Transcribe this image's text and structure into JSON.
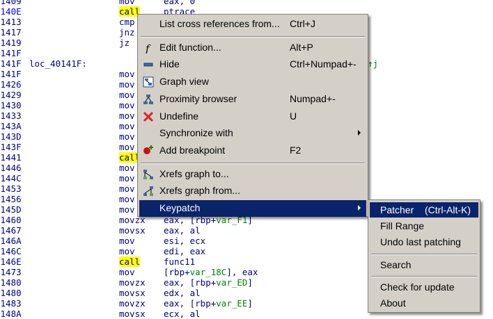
{
  "disasm": [
    {
      "addr": "01409",
      "mn": "mov",
      "op": "eax, 0"
    },
    {
      "addr": "0140E",
      "mn": "call",
      "op": "ptrace",
      "call": true,
      "addr_blue": true
    },
    {
      "addr": "01413",
      "mn": "cmp",
      "op": ""
    },
    {
      "addr": "01417",
      "mn": "jnz",
      "op": ""
    },
    {
      "addr": "01419",
      "mn": "jz",
      "op": ""
    },
    {
      "addr": "0141F",
      "mn": "",
      "op": ""
    },
    {
      "addr": "0141F",
      "label": "loc_40141F:",
      "mn": "",
      "op": "",
      "xref": "↑j"
    },
    {
      "addr": "0141F",
      "mn": "mov",
      "op": ""
    },
    {
      "addr": "01426",
      "mn": "mov",
      "op": ""
    },
    {
      "addr": "01429",
      "mn": "mov",
      "op": ""
    },
    {
      "addr": "01430",
      "mn": "mov",
      "op": ""
    },
    {
      "addr": "01433",
      "mn": "mov",
      "op": ""
    },
    {
      "addr": "0143A",
      "mn": "mov",
      "op": ""
    },
    {
      "addr": "0143D",
      "mn": "mov",
      "op": ""
    },
    {
      "addr": "0143F",
      "mn": "mov",
      "op": ""
    },
    {
      "addr": "01441",
      "mn": "call",
      "op": "",
      "call": true
    },
    {
      "addr": "01446",
      "mn": "mov",
      "op": ""
    },
    {
      "addr": "0144C",
      "mn": "mov",
      "op": ""
    },
    {
      "addr": "01453",
      "mn": "mov",
      "op": ""
    },
    {
      "addr": "01456",
      "mn": "mov",
      "op": ""
    },
    {
      "addr": "0145D",
      "mn": "mov",
      "op": ""
    },
    {
      "addr": "01460",
      "mn": "movzx",
      "op": "eax, [rbp+",
      "var": "var_F1",
      "op2": "]"
    },
    {
      "addr": "01467",
      "mn": "movsx",
      "op": "eax, al"
    },
    {
      "addr": "0146A",
      "mn": "mov",
      "op": "esi, ecx"
    },
    {
      "addr": "0146C",
      "mn": "mov",
      "op": "edi, eax"
    },
    {
      "addr": "0146E",
      "mn": "call",
      "op": "func11",
      "call": true
    },
    {
      "addr": "01473",
      "mn": "mov",
      "op": "[rbp+",
      "var": "var_18C",
      "op2": "], eax"
    },
    {
      "addr": "01480",
      "mn": "movzx",
      "op": "eax, [rbp+",
      "var": "var_ED",
      "op2": "]"
    },
    {
      "addr": "01480",
      "mn": "movsx",
      "op": "edx, al"
    },
    {
      "addr": "01483",
      "mn": "movzx",
      "op": "eax, [rbp+",
      "var": "var_EE",
      "op2": "]"
    },
    {
      "addr": "0148A",
      "mn": "movsx",
      "op": "ecx, al"
    }
  ],
  "context_menu": {
    "items": [
      {
        "label": "List cross references from...",
        "shortcut": "Ctrl+J",
        "icon": "none"
      },
      {
        "sep": true
      },
      {
        "label": "Edit function...",
        "shortcut": "Alt+P",
        "icon": "function-icon"
      },
      {
        "label": "Hide",
        "shortcut": "Ctrl+Numpad+-",
        "icon": "hide-icon"
      },
      {
        "label": "Graph view",
        "shortcut": "",
        "icon": "graph-view-icon"
      },
      {
        "label": "Proximity browser",
        "shortcut": "Numpad+-",
        "icon": "proximity-icon"
      },
      {
        "label": "Undefine",
        "shortcut": "U",
        "icon": "undefine-icon"
      },
      {
        "label": "Synchronize with",
        "shortcut": "",
        "icon": "none",
        "submenu": true
      },
      {
        "label": "Add breakpoint",
        "shortcut": "F2",
        "icon": "breakpoint-icon"
      },
      {
        "sep": true
      },
      {
        "label": "Xrefs graph to...",
        "shortcut": "",
        "icon": "xrefs-to-icon"
      },
      {
        "label": "Xrefs graph from...",
        "shortcut": "",
        "icon": "xrefs-from-icon"
      },
      {
        "label": "Keypatch",
        "shortcut": "",
        "icon": "none",
        "submenu": true,
        "selected": true
      }
    ]
  },
  "keypatch_menu": {
    "items": [
      {
        "label": "Patcher",
        "shortcut": "(Ctrl-Alt-K)",
        "selected": true
      },
      {
        "label": "Fill Range",
        "shortcut": ""
      },
      {
        "label": "Undo last patching",
        "shortcut": ""
      },
      {
        "sep": true
      },
      {
        "label": "Search",
        "shortcut": ""
      },
      {
        "sep": true
      },
      {
        "label": "Check for update",
        "shortcut": ""
      },
      {
        "label": "About",
        "shortcut": ""
      }
    ]
  },
  "colors": {
    "selection": "#0a246a",
    "menu_bg": "#d4d0c8",
    "call_highlight": "#ffff00",
    "code_text": "#000080",
    "variable": "#008000"
  }
}
